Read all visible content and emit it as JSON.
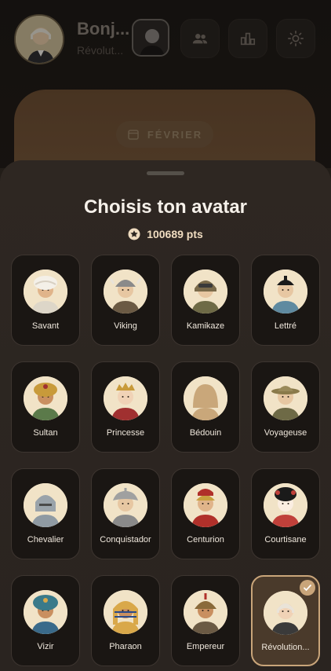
{
  "header": {
    "greeting": "Bonj...",
    "subtitle": "Révolut..."
  },
  "month_card": {
    "month_label": "FÉVRIER"
  },
  "sheet": {
    "title": "Choisis ton avatar",
    "points": "100689 pts"
  },
  "avatars": [
    {
      "label": "",
      "hair": "#555",
      "skin": "#e7c7a2",
      "outfit": "#8a7a64",
      "hat": "none"
    },
    {
      "label": "",
      "hair": "#555",
      "skin": "#e7c7a2",
      "outfit": "#8a7a64",
      "hat": "none"
    },
    {
      "label": "",
      "hair": "#555",
      "skin": "#e7c7a2",
      "outfit": "#8a7a64",
      "hat": "none"
    },
    {
      "label": "",
      "hair": "#555",
      "skin": "#e7c7a2",
      "outfit": "#8a7a64",
      "hat": "none"
    },
    {
      "label": "Savant",
      "hair": "#e9e3d8",
      "skin": "#e0b48a",
      "outfit": "#ddd6c8",
      "hat": "turban-white"
    },
    {
      "label": "Viking",
      "hair": "#d9a84a",
      "skin": "#e7c7a2",
      "outfit": "#6b5a44",
      "hat": "helmet"
    },
    {
      "label": "Kamikaze",
      "hair": "#4a3a2a",
      "skin": "#e7c7a2",
      "outfit": "#6e6a46",
      "hat": "aviator"
    },
    {
      "label": "Lettré",
      "hair": "#1a1a1a",
      "skin": "#e7c7a2",
      "outfit": "#5f8aa0",
      "hat": "cap-black"
    },
    {
      "label": "Sultan",
      "hair": "#3a2a1a",
      "skin": "#c98f60",
      "outfit": "#5b7a4a",
      "hat": "turban-gold"
    },
    {
      "label": "Princesse",
      "hair": "#1a1a1a",
      "skin": "#f0d2b6",
      "outfit": "#a03030",
      "hat": "crown"
    },
    {
      "label": "Bédouin",
      "hair": "#3a2a1a",
      "skin": "#b9825a",
      "outfit": "#c9a77a",
      "hat": "hood-sand"
    },
    {
      "label": "Voyageuse",
      "hair": "#6b4a2a",
      "skin": "#e7c7a2",
      "outfit": "#6e6a46",
      "hat": "safari"
    },
    {
      "label": "Chevalier",
      "hair": "#888",
      "skin": "#e7c7a2",
      "outfit": "#8f9aa3",
      "hat": "knight"
    },
    {
      "label": "Conquistador",
      "hair": "#4a3a2a",
      "skin": "#e7c7a2",
      "outfit": "#8a8a8a",
      "hat": "morion"
    },
    {
      "label": "Centurion",
      "hair": "#4a3a2a",
      "skin": "#e0b48a",
      "outfit": "#b0302a",
      "hat": "plume"
    },
    {
      "label": "Courtisane",
      "hair": "#1a1a1a",
      "skin": "#fbeee2",
      "outfit": "#c0403a",
      "hat": "geisha"
    },
    {
      "label": "Vizir",
      "hair": "#3a2a1a",
      "skin": "#c98f60",
      "outfit": "#3a6a8a",
      "hat": "turban-teal"
    },
    {
      "label": "Pharaon",
      "hair": "#1a1a1a",
      "skin": "#c98f60",
      "outfit": "#d9a84a",
      "hat": "nemes"
    },
    {
      "label": "Empereur",
      "hair": "#3a2a1a",
      "skin": "#c98f60",
      "outfit": "#6b5a44",
      "hat": "mongol"
    },
    {
      "label": "Révolution...",
      "hair": "#e9e3d8",
      "skin": "#f0d2b6",
      "outfit": "#3a3a3a",
      "hat": "none",
      "selected": true
    }
  ],
  "colors": {
    "accent": "#c9a57a",
    "sheet_bg": "#2e2722",
    "tile_bg": "#1a1613"
  }
}
